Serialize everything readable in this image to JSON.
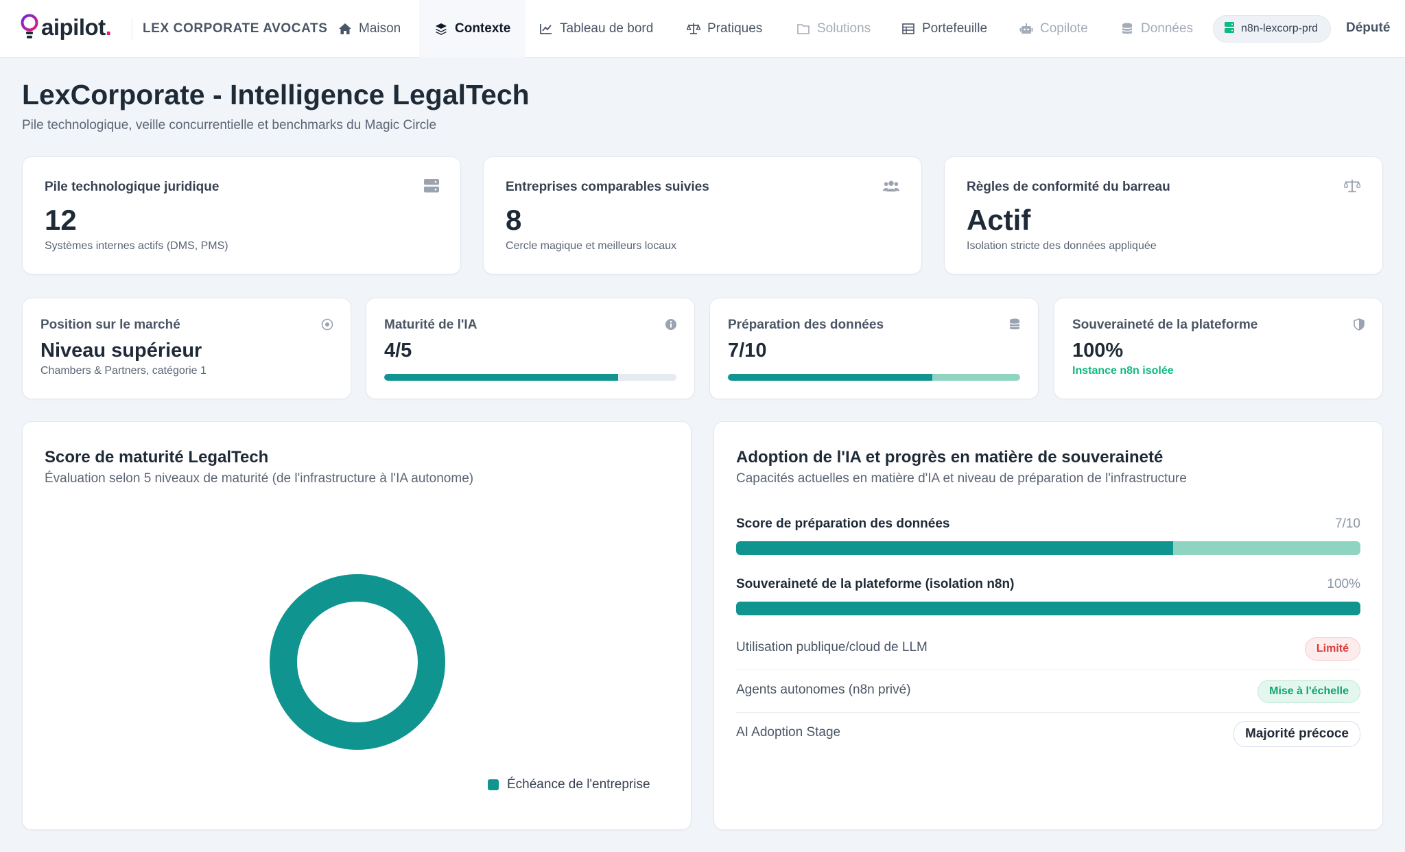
{
  "nav": {
    "logo": "aipilot",
    "logo_dot": ".",
    "company": "LEX CORPORATE AVOCATS",
    "items": [
      {
        "label": "Maison",
        "icon": "home-icon"
      },
      {
        "label": "Contexte",
        "icon": "layers-icon"
      },
      {
        "label": "Tableau de bord",
        "icon": "chart-line-icon"
      },
      {
        "label": "Pratiques",
        "icon": "scale-icon"
      },
      {
        "label": "Solutions",
        "icon": "folder-icon"
      },
      {
        "label": "Portefeuille",
        "icon": "table-icon"
      },
      {
        "label": "Copilote",
        "icon": "robot-icon"
      },
      {
        "label": "Données",
        "icon": "database-icon"
      }
    ],
    "instance": "n8n-lexcorp-prd",
    "user": "Député"
  },
  "header": {
    "title": "LexCorporate - Intelligence LegalTech",
    "subtitle": "Pile technologique, veille concurrentielle et benchmarks du Magic Circle"
  },
  "kpis": [
    {
      "label": "Pile technologique juridique",
      "value": "12",
      "sub": "Systèmes internes actifs (DMS, PMS)",
      "icon": "server-icon"
    },
    {
      "label": "Entreprises comparables suivies",
      "value": "8",
      "sub": "Cercle magique et meilleurs locaux",
      "icon": "users-icon"
    },
    {
      "label": "Règles de conformité du barreau",
      "value": "Actif",
      "sub": "Isolation stricte des données appliquée",
      "icon": "scale-icon"
    }
  ],
  "metrics": [
    {
      "label": "Position sur le marché",
      "value": "Niveau supérieur",
      "sub": "Chambers & Partners, catégorie 1",
      "icon": "target-icon"
    },
    {
      "label": "Maturité de l'IA",
      "value": "4/5",
      "progress": 0.8,
      "icon": "info-icon"
    },
    {
      "label": "Préparation des données",
      "value": "7/10",
      "progress": 0.7,
      "icon": "database-icon"
    },
    {
      "label": "Souveraineté de la plateforme",
      "value": "100%",
      "sub": "Instance n8n isolée",
      "icon": "shield-icon"
    }
  ],
  "maturity_panel": {
    "title": "Score de maturité LegalTech",
    "subtitle": "Évaluation selon 5 niveaux de maturité (de l'infrastructure à l'IA autonome)",
    "legend": "Échéance de l'entreprise"
  },
  "chart_data": {
    "type": "pie",
    "series": [
      {
        "name": "Échéance de l'entreprise",
        "values": [
          1
        ]
      }
    ],
    "colors": [
      "#0f9490"
    ],
    "legend_position": "bottom-right"
  },
  "adoption_panel": {
    "title": "Adoption de l'IA et progrès en matière de souveraineté",
    "subtitle": "Capacités actuelles en matière d'IA et niveau de préparation de l'infrastructure",
    "bars": [
      {
        "label": "Score de préparation des données",
        "value": "7/10",
        "progress": 0.7
      },
      {
        "label": "Souveraineté de la plateforme (isolation n8n)",
        "value": "100%",
        "progress": 1.0
      }
    ],
    "statuses": [
      {
        "label": "Utilisation publique/cloud de LLM",
        "badge": "Limité",
        "tone": "red"
      },
      {
        "label": "Agents autonomes (n8n privé)",
        "badge": "Mise à l'échelle",
        "tone": "green"
      },
      {
        "label": "AI Adoption Stage",
        "badge": "Majorité précoce",
        "tone": "neutral"
      }
    ]
  },
  "colors": {
    "accent": "#0f9490",
    "accent_light": "#8fd3c1",
    "brand_pink": "#e11d74",
    "success": "#10b981",
    "danger": "#dc3b3b"
  }
}
